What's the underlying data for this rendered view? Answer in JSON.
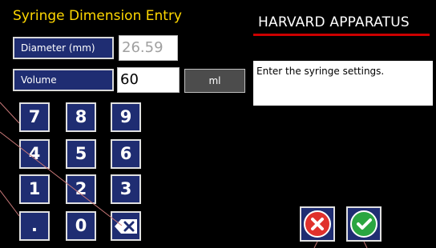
{
  "header": {
    "title": "Syringe Dimension Entry",
    "brand": "HARVARD APPARATUS"
  },
  "diameter": {
    "label": "Diameter (mm)",
    "value": "26.59"
  },
  "volume": {
    "label": "Volume",
    "value": "60",
    "unit": "ml"
  },
  "message": "Enter the syringe settings.",
  "keypad": [
    "7",
    "8",
    "9",
    "4",
    "5",
    "6",
    "1",
    "2",
    "3",
    ".",
    "0"
  ],
  "icons": {
    "backspace": "backspace-icon",
    "cancel": "cancel-icon",
    "confirm": "confirm-icon"
  },
  "colors": {
    "title": "#ffd700",
    "button": "#1f2d72",
    "accent_line": "#cc0000",
    "cancel": "#e0312c",
    "confirm": "#2aa640"
  }
}
